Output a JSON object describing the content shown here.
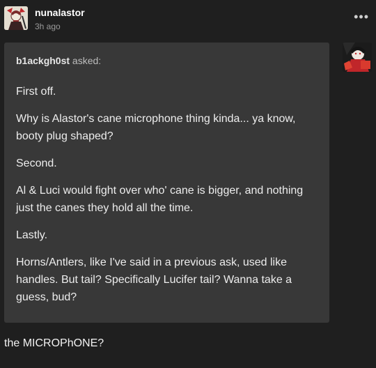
{
  "post": {
    "username": "nunalastor",
    "timestamp": "3h ago",
    "menu_label": "•••",
    "ask": {
      "asker": "b1ackgh0st",
      "asked_label": " asked:",
      "paragraphs": [
        "First off.",
        "Why is Alastor's cane microphone thing kinda... ya know, booty plug shaped?",
        "Second.",
        "Al & Luci would fight over who' cane is bigger, and nothing just the canes they hold all the time.",
        "Lastly.",
        "Horns/Antlers, like I've said in a previous ask, used like handles. But tail? Specifically Lucifer tail? Wanna take a guess, bud?"
      ]
    },
    "answer": "the MICROPhONE?"
  },
  "colors": {
    "background": "#1f1f1f",
    "ask_box": "#383838",
    "accent_red": "#c0262a"
  },
  "icons": {
    "user_avatar": "user-avatar-icon",
    "asker_avatar": "asker-avatar-icon",
    "menu": "more-options-icon"
  }
}
